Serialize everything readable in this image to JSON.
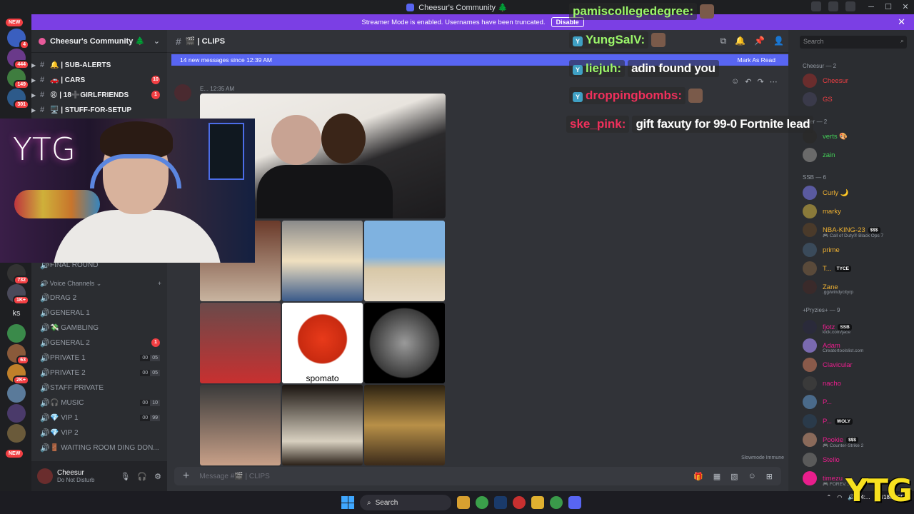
{
  "window": {
    "title": "Cheesur's Community 🌲"
  },
  "streamer_bar": {
    "text": "Streamer Mode is enabled. Usernames have been truncated.",
    "disable_label": "Disable"
  },
  "guilds": {
    "new_top": "NEW",
    "new_bottom": "NEW",
    "badges": [
      "4",
      "444",
      "149",
      "301",
      "732",
      "1K+",
      "63",
      "2K+"
    ],
    "ks_label": "ks"
  },
  "server": {
    "name": "Cheesur's Community 🌲"
  },
  "channels": [
    {
      "label": "🔔 | SUB-ALERTS",
      "badge": ""
    },
    {
      "label": "🚗 | CARS",
      "badge": "10"
    },
    {
      "label": "😩 | 18➕GIRLFRIENDS",
      "badge": "1"
    },
    {
      "label": "🖥️ | STUFF-FOR-SETUP",
      "badge": ""
    }
  ],
  "voice_header": "Voice Channels",
  "voice_channels": [
    {
      "label": "FINAL ROUND",
      "occ": [
        "",
        ""
      ],
      "badge": ""
    },
    {
      "label": "DRAG 2",
      "occ": [
        "",
        ""
      ],
      "badge": ""
    },
    {
      "label": "GENERAL 1",
      "occ": [
        "",
        ""
      ],
      "badge": ""
    },
    {
      "label": "💸 GAMBLING",
      "occ": [
        "",
        ""
      ],
      "badge": ""
    },
    {
      "label": "GENERAL 2",
      "occ": [
        "",
        ""
      ],
      "badge": "1"
    },
    {
      "label": "PRIVATE 1",
      "occ": [
        "00",
        "05"
      ],
      "badge": ""
    },
    {
      "label": "PRIVATE 2",
      "occ": [
        "00",
        "05"
      ],
      "badge": ""
    },
    {
      "label": "STAFF PRIVATE",
      "occ": [
        "",
        ""
      ],
      "badge": ""
    },
    {
      "label": "🎧 MUSIC",
      "occ": [
        "00",
        "10"
      ],
      "badge": ""
    },
    {
      "label": "💎 VIP 1",
      "occ": [
        "00",
        "99"
      ],
      "badge": ""
    },
    {
      "label": "💎 VIP 2",
      "occ": [
        "",
        ""
      ],
      "badge": ""
    },
    {
      "label": "🚪 WAITING ROOM DING DON...",
      "occ": [
        "",
        ""
      ],
      "badge": ""
    }
  ],
  "user": {
    "name": "Cheesur",
    "status": "Do Not Disturb"
  },
  "chat": {
    "channel": "🎬 | CLIPS",
    "new_messages": "14 new messages since 12:39 AM",
    "mark_as_read": "Mark As Read",
    "msg_author": "E...",
    "msg_time": "12:35 AM",
    "tile_label": "spomato",
    "slowmode": "Slowmode Immune",
    "placeholder": "Message #🎬 | CLIPS"
  },
  "members": {
    "search_placeholder": "Search",
    "groups": [
      {
        "title": "Cheesur — 2"
      },
      {
        "title": "wner — 2"
      },
      {
        "title": "SSB — 6"
      },
      {
        "title": "+Pryzies+ — 9"
      }
    ],
    "list": [
      {
        "name": "Cheesur",
        "sub": "",
        "tag": "",
        "color": "#f23f43"
      },
      {
        "name": "GS",
        "sub": "",
        "tag": "",
        "color": "#f23f43"
      },
      {
        "name": "verts 🎨",
        "sub": "",
        "tag": "",
        "color": "#43d158"
      },
      {
        "name": "zain",
        "sub": "",
        "tag": "",
        "color": "#43d158"
      },
      {
        "name": "Curly 🌙",
        "sub": "",
        "tag": "",
        "color": "#f0b232"
      },
      {
        "name": "marky",
        "sub": "",
        "tag": "",
        "color": "#f0b232"
      },
      {
        "name": "NBA-KING-23",
        "sub": "🎮 Call of Duty® Black Ops 7",
        "tag": "$$$",
        "color": "#f0b232"
      },
      {
        "name": "prime",
        "sub": "",
        "tag": "",
        "color": "#f0b232"
      },
      {
        "name": "T...",
        "sub": "",
        "tag": "TYCE",
        "color": "#f0b232"
      },
      {
        "name": "Zane",
        "sub": ".gg/windycityrp",
        "tag": "",
        "color": "#f0b232"
      },
      {
        "name": "fjotz",
        "sub": "kick.com/jace",
        "tag": "SSB",
        "color": "#e91e8c"
      },
      {
        "name": "Adam",
        "sub": "Creatortoolslist.com",
        "tag": "",
        "color": "#e91e8c"
      },
      {
        "name": "Clavicular",
        "sub": "",
        "tag": "",
        "color": "#e91e8c"
      },
      {
        "name": "nacho",
        "sub": "",
        "tag": "",
        "color": "#e91e8c"
      },
      {
        "name": "P...",
        "sub": "",
        "tag": "",
        "color": "#e91e8c"
      },
      {
        "name": "P...",
        "sub": "",
        "tag": "WOLY",
        "color": "#e91e8c"
      },
      {
        "name": "Pookie",
        "sub": "🎮 Counter-Strike 2",
        "tag": "$$$",
        "color": "#e91e8c"
      },
      {
        "name": "Stello",
        "sub": "",
        "tag": "",
        "color": "#e91e8c"
      },
      {
        "name": "timezu",
        "sub": "🎮 FOREV...",
        "tag": "",
        "color": "#e91e8c"
      }
    ]
  },
  "overlay": [
    {
      "name": "pamiscollegedegree:",
      "msg": "",
      "name_color": "#9cf76a"
    },
    {
      "name": "YungSalV:",
      "msg": "",
      "name_color": "#9cf76a"
    },
    {
      "name": "liejuh:",
      "msg": "adin found you",
      "name_color": "#9cf76a"
    },
    {
      "name": "droppingbombs:",
      "msg": "",
      "name_color": "#f0305c"
    },
    {
      "name": "ske_pink:",
      "msg": "gift faxuty for 99-0 Fortnite lead",
      "name_color": "#f0305c"
    }
  ],
  "webcam": {
    "text": "YTG"
  },
  "corner_logo": "YTG",
  "taskbar": {
    "search": "Search",
    "date": "11/18/2025",
    "time": "4:..."
  },
  "colors": {
    "accent": "#5865f2",
    "streamer_bar": "#7b3fe4",
    "danger": "#f23f43"
  }
}
